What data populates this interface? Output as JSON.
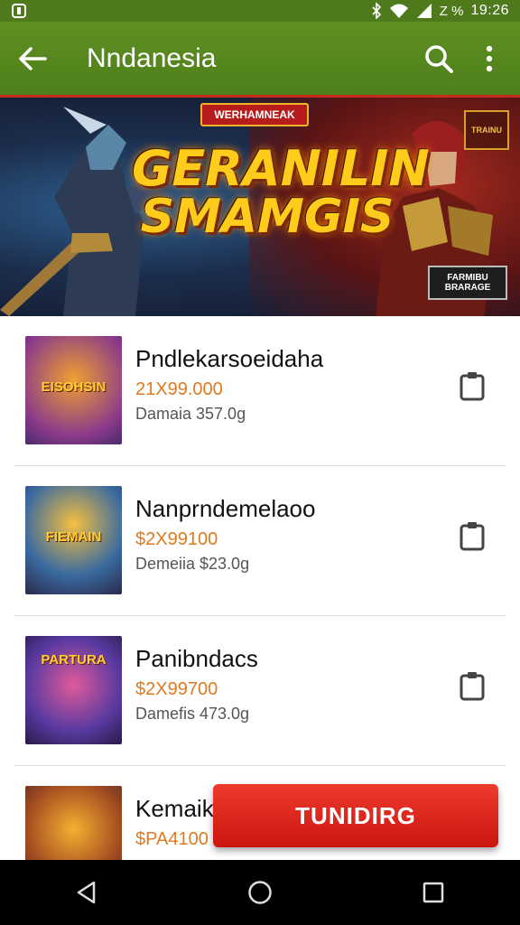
{
  "status_bar": {
    "battery_text": "Z %",
    "time": "19:26"
  },
  "app_bar": {
    "title": "Nndanesia"
  },
  "banner": {
    "tag": "WERHAMNEAK",
    "headline_line1": "GERANILIN",
    "headline_line2": "SMAMGIS",
    "corner_badge": "TRAINU",
    "bottom_badge": "FARMIBU BRARAGE"
  },
  "items": [
    {
      "name": "Pndlekarsoeidaha",
      "price": "21X99.000",
      "sub": "Damaia 357.0g",
      "thumb_text": "EISOHSIN"
    },
    {
      "name": "Nanprndemelaoo",
      "price": "$2X99100",
      "sub": "Demeiia $23.0g",
      "thumb_text": "FIEMAIN"
    },
    {
      "name": "Panibndacs",
      "price": "$2X99700",
      "sub": "Damefis 473.0g",
      "thumb_text": "PARTURA"
    },
    {
      "name": "Kemaik",
      "price": "$PA4100",
      "sub": "",
      "thumb_text": ""
    }
  ],
  "cta": {
    "label": "TUNIDIRG"
  },
  "colors": {
    "app_bar": "#5a8a20",
    "accent_red": "#d32f2f",
    "price": "#e07a1f"
  }
}
